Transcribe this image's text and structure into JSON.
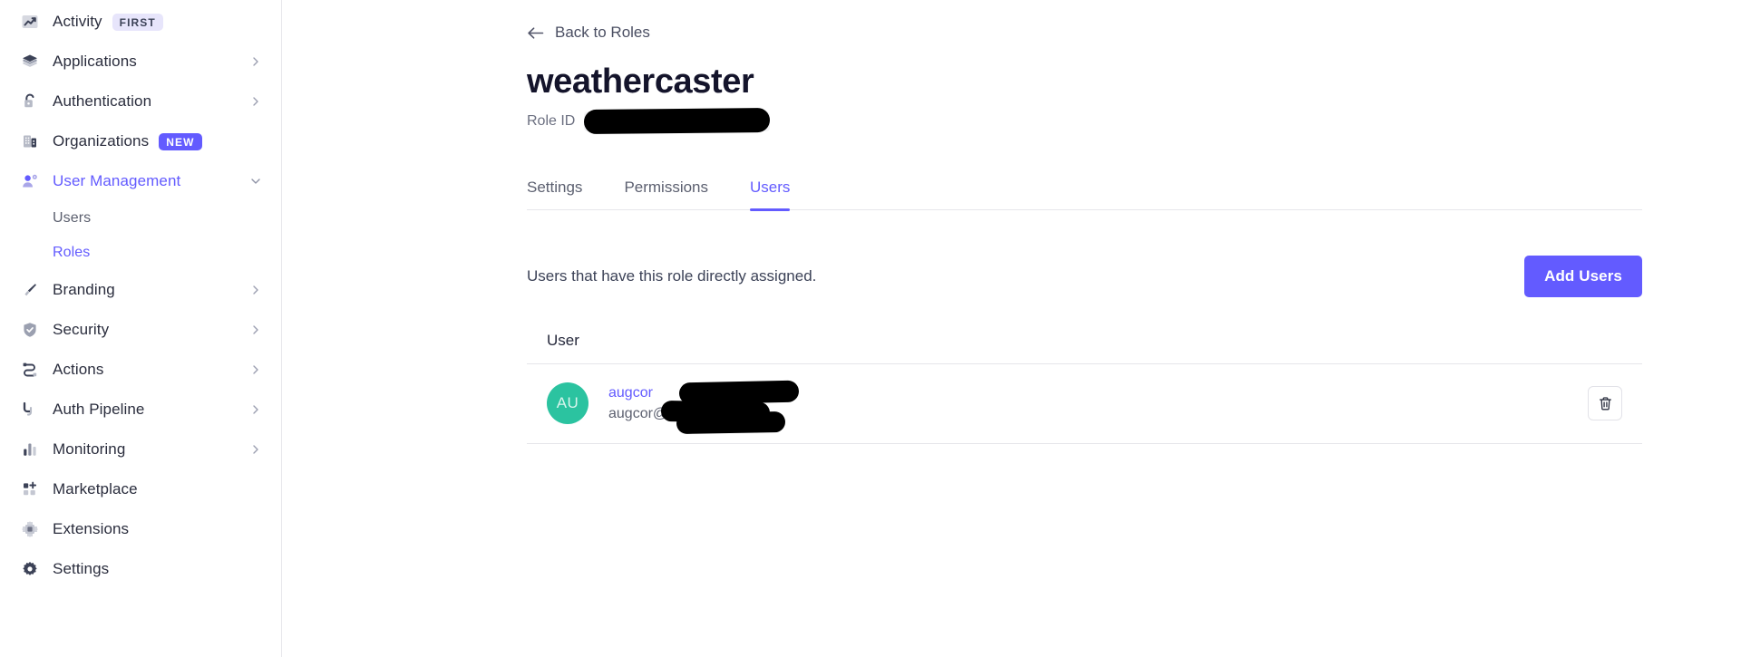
{
  "sidebar": {
    "items": [
      {
        "label": "Activity",
        "icon": "activity-chart-icon",
        "badge": "FIRST",
        "badge_style": "first",
        "chevron": false,
        "active": false
      },
      {
        "label": "Applications",
        "icon": "stack-layers-icon",
        "badge": null,
        "badge_style": null,
        "chevron": true,
        "active": false
      },
      {
        "label": "Authentication",
        "icon": "lock-icon",
        "badge": null,
        "badge_style": null,
        "chevron": true,
        "active": false
      },
      {
        "label": "Organizations",
        "icon": "building-icon",
        "badge": "NEW",
        "badge_style": "new",
        "chevron": false,
        "active": false
      },
      {
        "label": "User Management",
        "icon": "user-gear-icon",
        "badge": null,
        "badge_style": null,
        "chevron": "down",
        "active": true
      }
    ],
    "sub_items": [
      {
        "label": "Users",
        "active": false
      },
      {
        "label": "Roles",
        "active": true
      }
    ],
    "items_after": [
      {
        "label": "Branding",
        "icon": "paintbrush-icon",
        "chevron": true,
        "active": false
      },
      {
        "label": "Security",
        "icon": "shield-check-icon",
        "chevron": true,
        "active": false
      },
      {
        "label": "Actions",
        "icon": "actions-flow-icon",
        "chevron": true,
        "active": false
      },
      {
        "label": "Auth Pipeline",
        "icon": "pipeline-icon",
        "chevron": true,
        "active": false
      },
      {
        "label": "Monitoring",
        "icon": "bar-chart-icon",
        "chevron": true,
        "active": false
      },
      {
        "label": "Marketplace",
        "icon": "grid-plus-icon",
        "chevron": false,
        "active": false
      },
      {
        "label": "Extensions",
        "icon": "extension-chip-icon",
        "chevron": false,
        "active": false
      },
      {
        "label": "Settings",
        "icon": "gear-icon",
        "chevron": false,
        "active": false
      }
    ]
  },
  "main": {
    "back_link": "Back to Roles",
    "back_icon": "arrow-left-icon",
    "title": "weathercaster",
    "role_id_label": "Role ID",
    "role_id_value": "",
    "tabs": [
      {
        "label": "Settings",
        "active": false
      },
      {
        "label": "Permissions",
        "active": false
      },
      {
        "label": "Users",
        "active": true
      }
    ],
    "description": "Users that have this role directly assigned.",
    "add_users_label": "Add Users",
    "table": {
      "header": "User",
      "rows": [
        {
          "initials": "AU",
          "name": "augcor",
          "email": "augcor@",
          "delete_icon": "trash-icon"
        }
      ]
    }
  },
  "colors": {
    "accent": "#635bff",
    "avatar": "#2bc3a0",
    "badge_new_bg": "#635bff",
    "badge_first_bg": "#e7e5fb",
    "border": "#e6e6ea",
    "text": "#2a2d3d"
  }
}
